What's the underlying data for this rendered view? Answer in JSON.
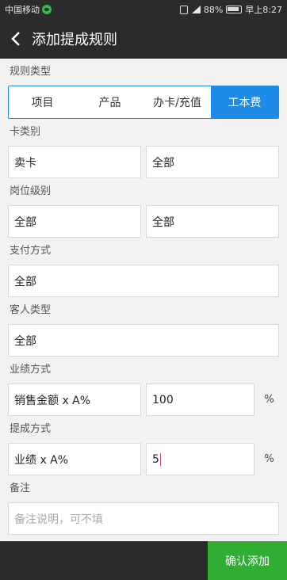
{
  "status_bar": {
    "carrier": "中国移动",
    "battery": "88%",
    "time": "早上8:27"
  },
  "nav": {
    "title": "添加提成规则"
  },
  "rule_type": {
    "label": "规则类型",
    "tabs": [
      {
        "label": "项目",
        "active": false
      },
      {
        "label": "产品",
        "active": false
      },
      {
        "label": "办卡/充值",
        "active": false
      },
      {
        "label": "工本费",
        "active": true
      }
    ]
  },
  "card_category": {
    "label": "卡类别",
    "value_left": "卖卡",
    "value_right": "全部"
  },
  "position_level": {
    "label": "岗位级别",
    "value_left": "全部",
    "value_right": "全部"
  },
  "payment_method": {
    "label": "支付方式",
    "value": "全部"
  },
  "customer_type": {
    "label": "客人类型",
    "value": "全部"
  },
  "performance_method": {
    "label": "业绩方式",
    "formula": "销售金额 x A%",
    "value": "100",
    "unit": "%"
  },
  "commission_method": {
    "label": "提成方式",
    "formula": "业绩 x A%",
    "value": "5",
    "unit": "%"
  },
  "remark": {
    "label": "备注",
    "placeholder": "备注说明，可不填"
  },
  "footer": {
    "confirm_label": "确认添加"
  },
  "colors": {
    "accent": "#1d8ae6",
    "confirm": "#2fae33",
    "header": "#2b2b2b"
  }
}
